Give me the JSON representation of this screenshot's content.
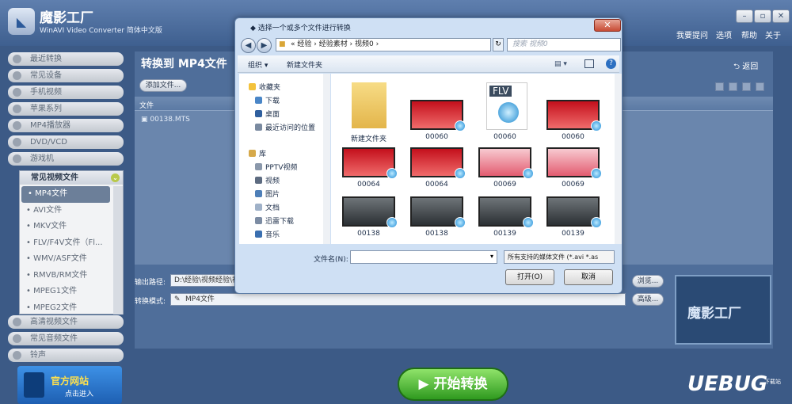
{
  "app": {
    "title": "魔影工厂",
    "subtitle": "WinAVI Video Converter 简体中文版",
    "top_links": [
      "我要提问",
      "选项",
      "帮助",
      "关于"
    ]
  },
  "sidebar": {
    "items": [
      "最近转换",
      "常见设备",
      "手机视频",
      "苹果系列",
      "MP4播放器",
      "DVD/VCD",
      "游戏机"
    ],
    "category": {
      "header": "常见视频文件",
      "items": [
        "• MP4文件",
        "• AVI文件",
        "• MKV文件",
        "• FLV/F4V文件（Fl...",
        "• WMV/ASF文件",
        "• RMVB/RM文件",
        "• MPEG1文件",
        "• MPEG2文件"
      ]
    },
    "bottom_items": [
      "高清视频文件",
      "常见音频文件",
      "铃声"
    ],
    "promo": {
      "title": "官方网站",
      "sub": "点击进入"
    }
  },
  "main": {
    "title": "转换到 MP4文件",
    "back": "返回",
    "add_file": "添加文件...",
    "column_file": "文件",
    "file_row": "00138.MTS",
    "output_label": "输出路径:",
    "output_value": "D:\\经验\\视频经验\\视频",
    "mode_label": "转换模式:",
    "mode_value": "MP4文件",
    "browse": "浏览...",
    "advanced": "高级...",
    "start": "开始转换",
    "preview_logo": "魔影工厂"
  },
  "watermark": {
    "text": "UEBUG",
    "sub": "下载站"
  },
  "dialog": {
    "title": "选择一个或多个文件进行转换",
    "address": "« 经验 › 经验素材 › 视频0 ›",
    "search_placeholder": "搜索 视频0",
    "organize": "组织 ▾",
    "new_folder": "新建文件夹",
    "nav": {
      "favorites": "收藏夹",
      "fav_items": [
        "下载",
        "桌面",
        "最近访问的位置"
      ],
      "library": "库",
      "lib_items": [
        "PPTV视频",
        "视频",
        "图片",
        "文档",
        "迅雷下载",
        "音乐"
      ]
    },
    "files": [
      {
        "name": "新建文件夹",
        "type": "folder"
      },
      {
        "name": "00060",
        "type": "red"
      },
      {
        "name": "00060",
        "type": "flv"
      },
      {
        "name": "00060",
        "type": "red"
      },
      {
        "name": "00064",
        "type": "red"
      },
      {
        "name": "00064",
        "type": "red"
      },
      {
        "name": "00069",
        "type": "pink"
      },
      {
        "name": "00069",
        "type": "pink"
      },
      {
        "name": "00138",
        "type": "car"
      },
      {
        "name": "00138",
        "type": "car"
      },
      {
        "name": "00139",
        "type": "car"
      },
      {
        "name": "00139",
        "type": "car"
      }
    ],
    "flv_label": "FLV",
    "filename_label": "文件名(N):",
    "filename_value": "",
    "filetype": "所有支持的媒体文件 (*.avi *.as",
    "open": "打开(O)",
    "cancel": "取消"
  }
}
